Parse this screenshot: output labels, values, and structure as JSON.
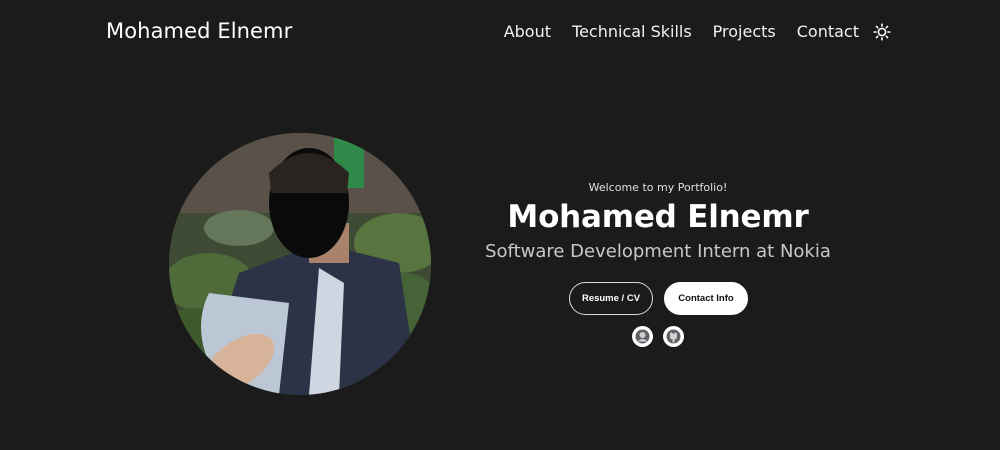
{
  "header": {
    "logo_text": "Mohamed Elnemr",
    "nav": [
      {
        "label": "About"
      },
      {
        "label": "Technical Skills"
      },
      {
        "label": "Projects"
      },
      {
        "label": "Contact"
      }
    ],
    "theme_icon": "sun-icon"
  },
  "hero": {
    "welcome": "Welcome to my Portfolio!",
    "name": "Mohamed Elnemr",
    "role": "Software Development Intern at Nokia",
    "buttons": {
      "resume": "Resume / CV",
      "contact": "Contact Info"
    },
    "socials": [
      {
        "icon": "linkedin-icon"
      },
      {
        "icon": "github-icon"
      }
    ]
  },
  "colors": {
    "background": "#1b1b1b",
    "text": "#ffffff",
    "muted": "#c8c8c8"
  }
}
